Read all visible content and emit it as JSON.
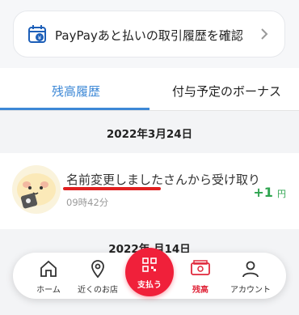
{
  "banner": {
    "label": "PayPayあと払いの取引履歴を確認"
  },
  "tabs": [
    {
      "label": "残高履歴",
      "active": true
    },
    {
      "label": "付与予定のボーナス",
      "active": false
    }
  ],
  "date_header": "2022年3月24日",
  "transaction": {
    "name": "名前変更しましたさんから受け取り",
    "time": "09時42分",
    "amount": "+1",
    "unit": "円"
  },
  "date_header_partial": "2022年 月14日",
  "nav": {
    "home": "ホーム",
    "nearby": "近くのお店",
    "pay": "支払う",
    "balance": "残高",
    "account": "アカウント"
  },
  "colors": {
    "accent": "#3d88d6",
    "positive": "#2ea44f",
    "brand_red": "#f0203a"
  }
}
